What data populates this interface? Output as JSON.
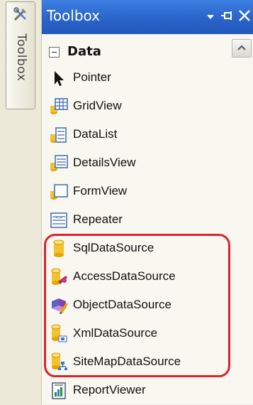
{
  "dock": {
    "label": "Toolbox"
  },
  "panel": {
    "title": "Toolbox"
  },
  "category": {
    "toggle": "−",
    "label": "Data"
  },
  "items": [
    {
      "label": "Pointer",
      "icon": "pointer-icon"
    },
    {
      "label": "GridView",
      "icon": "gridview-icon"
    },
    {
      "label": "DataList",
      "icon": "datalist-icon"
    },
    {
      "label": "DetailsView",
      "icon": "detailsview-icon"
    },
    {
      "label": "FormView",
      "icon": "formview-icon"
    },
    {
      "label": "Repeater",
      "icon": "repeater-icon"
    },
    {
      "label": "SqlDataSource",
      "icon": "sqldatasource-icon"
    },
    {
      "label": "AccessDataSource",
      "icon": "accessdatasource-icon"
    },
    {
      "label": "ObjectDataSource",
      "icon": "objectdatasource-icon"
    },
    {
      "label": "XmlDataSource",
      "icon": "xmldatasource-icon"
    },
    {
      "label": "SiteMapDataSource",
      "icon": "sitemapdatasource-icon"
    },
    {
      "label": "ReportViewer",
      "icon": "reportviewer-icon"
    }
  ],
  "colors": {
    "titlebar": "#2962c8",
    "highlight": "#e0202f"
  }
}
